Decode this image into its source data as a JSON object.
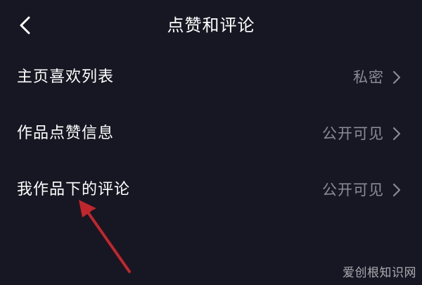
{
  "header": {
    "title": "点赞和评论",
    "back_icon": "chevron-left-icon"
  },
  "settings": {
    "items": [
      {
        "label": "主页喜欢列表",
        "value": "私密"
      },
      {
        "label": "作品点赞信息",
        "value": "公开可见"
      },
      {
        "label": "我作品下的评论",
        "value": "公开可见"
      }
    ],
    "chevron_icon": "chevron-right-icon"
  },
  "annotation": {
    "arrow_color": "#c0272d"
  },
  "watermark": {
    "text": "爱创根知识网"
  },
  "colors": {
    "background": "#161722",
    "primary_text": "#ffffff",
    "secondary_text": "#8a8b94"
  }
}
